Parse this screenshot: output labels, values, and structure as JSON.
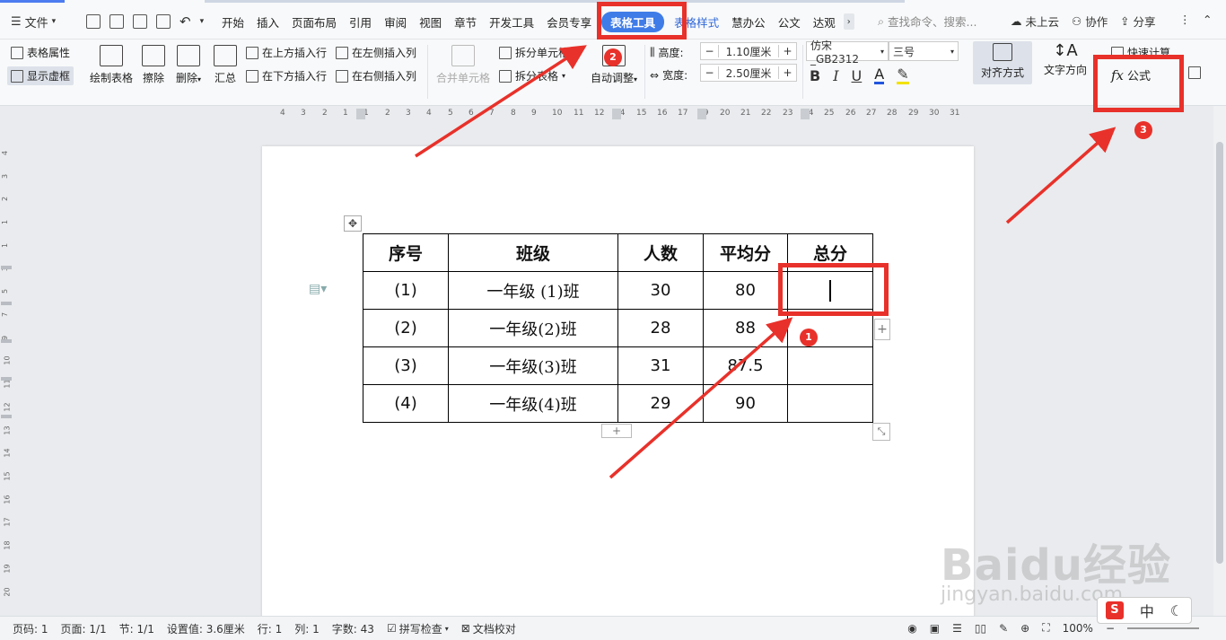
{
  "colors": {
    "accent": "#3f7ce8",
    "highlight": "#e8312a"
  },
  "topbar": {
    "file_label": "文件",
    "tabs": [
      "开始",
      "插入",
      "页面布局",
      "引用",
      "审阅",
      "视图",
      "章节",
      "开发工具",
      "会员专享",
      "表格工具",
      "表格样式",
      "慧办公",
      "公文",
      "达观"
    ],
    "search_placeholder": "查找命令、搜索...",
    "cloud": "未上云",
    "collab": "协作",
    "share": "分享"
  },
  "ribbon": {
    "table_props": "表格属性",
    "show_gridlines": "显示虚框",
    "draw_table": "绘制表格",
    "erase": "擦除",
    "delete": "删除",
    "summary": "汇总",
    "insert_above": "在上方插入行",
    "insert_below": "在下方插入行",
    "insert_left": "在左侧插入列",
    "insert_right": "在右侧插入列",
    "merge_cells": "合并单元格",
    "split_cells": "拆分单元格",
    "split_table": "拆分表格",
    "auto_fit": "自动调整",
    "height_label": "高度:",
    "height_value": "1.10厘米",
    "width_label": "宽度:",
    "width_value": "2.50厘米",
    "font_name": "仿宋_GB2312",
    "font_size": "三号",
    "align": "对齐方式",
    "text_direction": "文字方向",
    "quick_calc": "快速计算",
    "formula": "公式",
    "formula_icon": "fx"
  },
  "hruler_ticks": [
    "4",
    "3",
    "2",
    "1",
    "1",
    "2",
    "3",
    "4",
    "5",
    "6",
    "7",
    "8",
    "9",
    "10",
    "11",
    "12",
    "14",
    "15",
    "16",
    "17",
    "19",
    "20",
    "21",
    "22",
    "23",
    "24",
    "25",
    "26",
    "27",
    "28",
    "29",
    "30",
    "31"
  ],
  "vruler_ticks": [
    "4",
    "3",
    "2",
    "1",
    "1",
    "3",
    "5",
    "7",
    "9",
    "10",
    "11",
    "12",
    "13",
    "14",
    "15",
    "16",
    "17",
    "18",
    "19",
    "20"
  ],
  "table": {
    "headers": [
      "序号",
      "班级",
      "人数",
      "平均分",
      "总分"
    ],
    "rows": [
      [
        "(1)",
        "一年级 (1)班",
        "30",
        "80",
        ""
      ],
      [
        "(2)",
        "一年级(2)班",
        "28",
        "88",
        ""
      ],
      [
        "(3)",
        "一年级(3)班",
        "31",
        "87.5",
        ""
      ],
      [
        "(4)",
        "一年级(4)班",
        "29",
        "90",
        ""
      ]
    ]
  },
  "annotations": {
    "badge1": "1",
    "badge2": "2",
    "badge3": "3"
  },
  "statusbar": {
    "page_num": "页码: 1",
    "pages": "页面: 1/1",
    "section": "节: 1/1",
    "setting": "设置值: 3.6厘米",
    "row": "行: 1",
    "col": "列: 1",
    "words": "字数: 43",
    "spellcheck": "拼写检查",
    "doc_check": "文档校对",
    "zoom": "100%"
  },
  "watermark": {
    "brand": "Baidu经验",
    "url": "jingyan.baidu.com"
  },
  "ime": {
    "logo": "S",
    "mode": "中"
  }
}
